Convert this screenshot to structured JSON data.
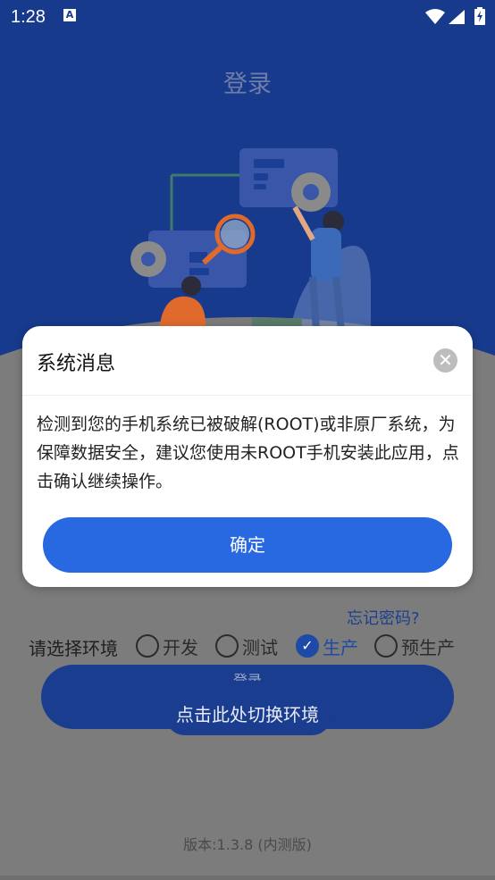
{
  "status_bar": {
    "time": "1:28",
    "notification_icon": "A"
  },
  "app": {
    "title": "登录",
    "environment": {
      "label": "请选择环境",
      "options": [
        {
          "label": "开发",
          "checked": false
        },
        {
          "label": "测试",
          "checked": false
        },
        {
          "label": "生产",
          "checked": true
        },
        {
          "label": "预生产",
          "checked": false
        }
      ]
    },
    "forgot_password": "忘记密码?",
    "login_button": "登录",
    "switch_env_tip": "点击此处切换环境",
    "version": "版本:1.3.8 (内测版)"
  },
  "dialog": {
    "title": "系统消息",
    "message": "检测到您的手机系统已被破解(ROOT)或非原厂系统，为保障数据安全，建议您使用未ROOT手机安装此应用，点击确认继续操作。",
    "confirm_label": "确定"
  },
  "colors": {
    "brand_blue": "#173a8c",
    "confirm_blue": "#2868e0",
    "overlay_gray": "#7c7c7c"
  }
}
